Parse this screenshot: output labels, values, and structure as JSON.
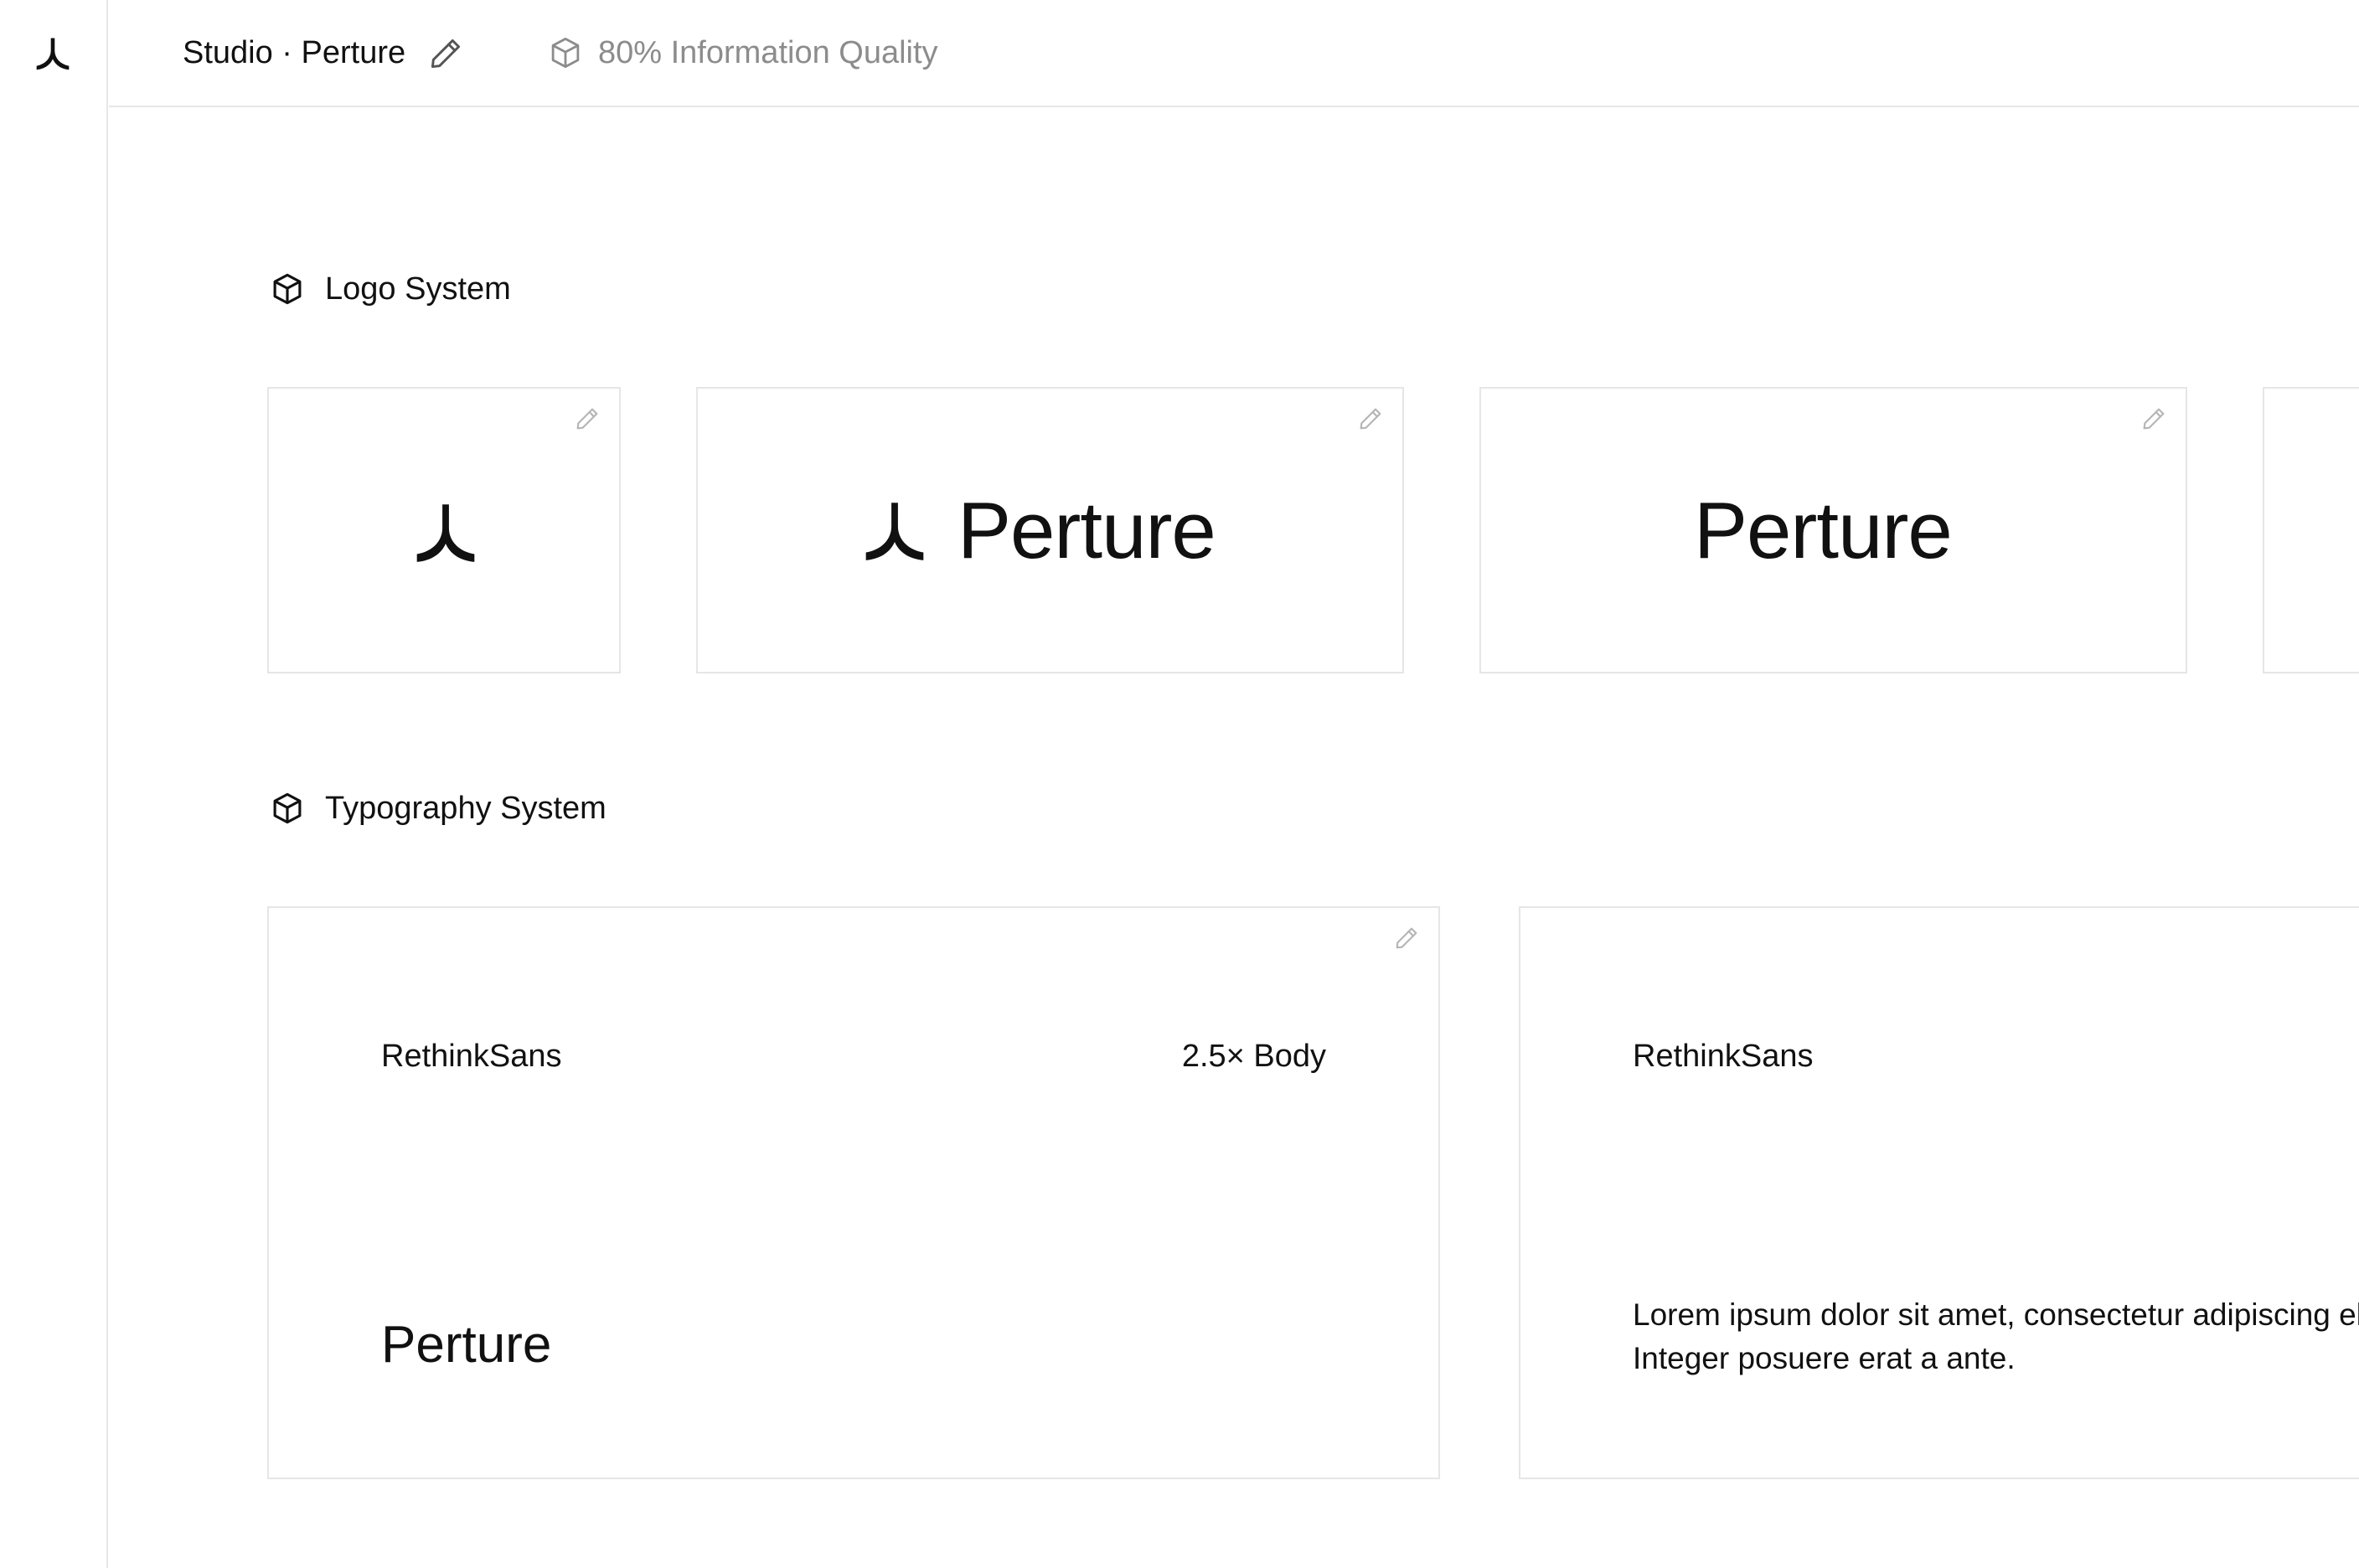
{
  "topbar": {
    "workspace": "Studio · Perture",
    "quality": "80% Information Quality"
  },
  "sections": {
    "logo": {
      "title": "Logo System",
      "cards": [
        {
          "kind": "mark"
        },
        {
          "kind": "mark+wordmark",
          "wordmark": "Perture"
        },
        {
          "kind": "wordmark",
          "wordmark": "Perture"
        }
      ]
    },
    "typography": {
      "title": "Typography System",
      "cards": [
        {
          "font": "RethinkSans",
          "scale": "2.5× Body",
          "sample": "Perture"
        },
        {
          "font": "RethinkSans",
          "body_lines": [
            "Lorem ipsum dolor sit amet, consectetur adipiscing elit.",
            "Integer posuere erat a ante."
          ]
        }
      ]
    }
  },
  "icons": {
    "brand": "perture-mark-icon",
    "edit": "pencil-icon",
    "section": "cube-icon"
  }
}
